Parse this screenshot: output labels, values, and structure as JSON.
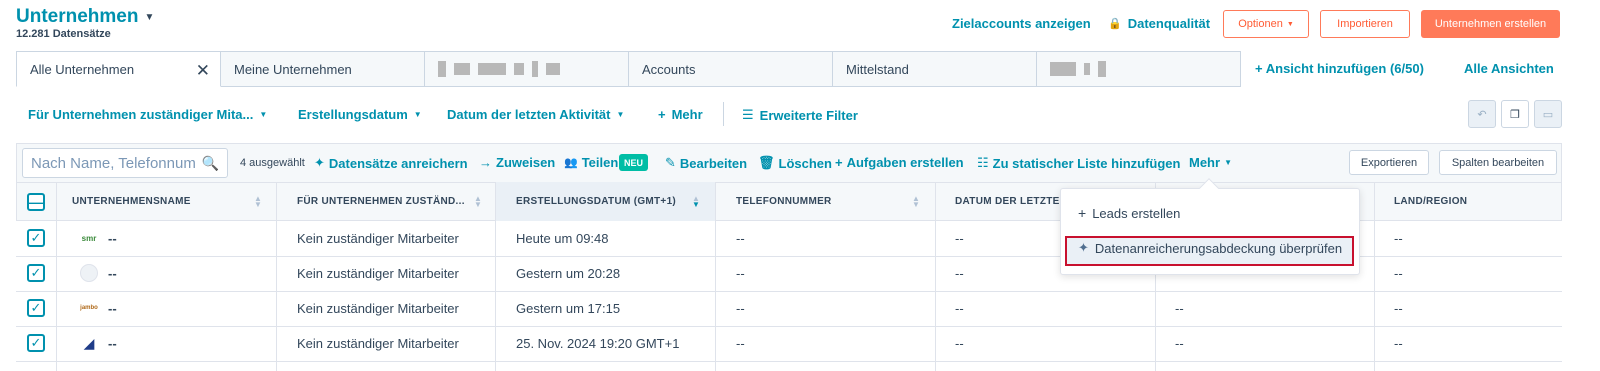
{
  "header": {
    "title": "Unternehmen",
    "record_count": "12.281 Datensätze",
    "target_accounts_link": "Zielaccounts anzeigen",
    "data_quality_link": "Datenqualität",
    "options_button": "Optionen",
    "import_button": "Importieren",
    "create_button": "Unternehmen erstellen"
  },
  "tabs": [
    {
      "label": "Alle Unternehmen"
    },
    {
      "label": "Meine Unternehmen"
    },
    {
      "label": ""
    },
    {
      "label": "Accounts"
    },
    {
      "label": "Mittelstand"
    },
    {
      "label": ""
    }
  ],
  "tabs_actions": {
    "add_view": "Ansicht hinzufügen (6/50)",
    "all_views": "Alle Ansichten"
  },
  "filters": {
    "owner": "Für Unternehmen zuständiger Mita...",
    "created": "Erstellungsdatum",
    "last_activity": "Datum der letzten Aktivität",
    "more": "Mehr",
    "advanced": "Erweiterte Filter"
  },
  "actionbar": {
    "search_placeholder": "Nach Name, Telefonnum",
    "selected": "4 ausgewählt",
    "enrich": "Datensätze anreichern",
    "assign": "Zuweisen",
    "share": "Teilen",
    "new_badge": "NEU",
    "edit": "Bearbeiten",
    "delete": "Löschen",
    "create_tasks": "Aufgaben erstellen",
    "add_static_list": "Zu statischer Liste hinzufügen",
    "more": "Mehr",
    "export": "Exportieren",
    "edit_columns": "Spalten bearbeiten"
  },
  "columns": [
    "UNTERNEHMENSNAME",
    "FÜR UNTERNEHMEN ZUSTÄND...",
    "ERSTELLUNGSDATUM (GMT+1)",
    "TELEFONNUMMER",
    "DATUM DER LETZTE",
    "LAND/REGION"
  ],
  "rows": [
    {
      "logo": "smr",
      "name": "--",
      "owner": "Kein zuständiger Mitarbeiter",
      "created": "Heute um 09:48",
      "phone": "--",
      "last": "--",
      "col6": "--",
      "country": "--"
    },
    {
      "logo": "",
      "name": "--",
      "owner": "Kein zuständiger Mitarbeiter",
      "created": "Gestern um 20:28",
      "phone": "--",
      "last": "--",
      "col6": "--",
      "country": "--"
    },
    {
      "logo": "jambo",
      "name": "--",
      "owner": "Kein zuständiger Mitarbeiter",
      "created": "Gestern um 17:15",
      "phone": "--",
      "last": "--",
      "col6": "--",
      "country": "--"
    },
    {
      "logo": "",
      "name": "--",
      "owner": "Kein zuständiger Mitarbeiter",
      "created": "25. Nov. 2024 19:20 GMT+1",
      "phone": "--",
      "last": "--",
      "col6": "--",
      "country": "--"
    }
  ],
  "dropdown": {
    "items": [
      {
        "label": "Leads erstellen"
      },
      {
        "label": "Datenanreicherungsabdeckung überprüfen"
      }
    ]
  },
  "colors": {
    "accent": "#0091ae",
    "primary_button": "#ff7a59",
    "badge": "#00bda5",
    "highlight_border": "#c8102e"
  }
}
